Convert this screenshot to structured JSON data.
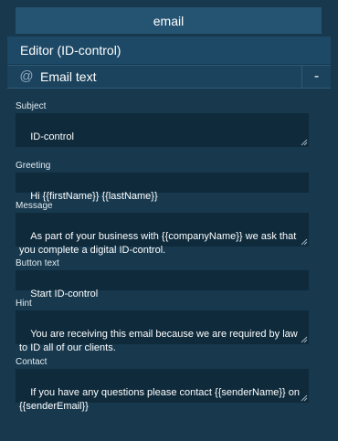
{
  "tab": {
    "label": "email"
  },
  "editor": {
    "title": "Editor (ID-control)"
  },
  "section": {
    "icon": "at-icon",
    "title": "Email text",
    "collapse_label": "-"
  },
  "fields": {
    "subject": {
      "label": "Subject",
      "value": "ID-control"
    },
    "greeting": {
      "label": "Greeting",
      "value": "Hi {{firstName}} {{lastName}}"
    },
    "message": {
      "label": "Message",
      "value": "As part of your business with {{companyName}} we ask that you complete a digital ID-control."
    },
    "button_text": {
      "label": "Button text",
      "value": "Start ID-control"
    },
    "hint": {
      "label": "Hint",
      "value": "You are receiving this email because we are required by law to ID all of our clients."
    },
    "contact": {
      "label": "Contact",
      "value": "If you have any questions please contact {{senderName}} on {{senderEmail}}"
    }
  }
}
